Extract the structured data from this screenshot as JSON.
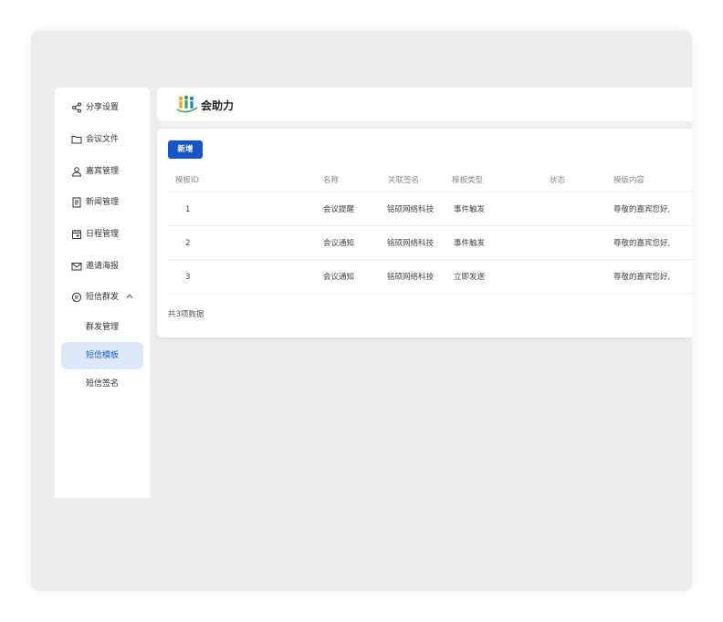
{
  "sidebar": {
    "items": [
      {
        "label": "分享设置",
        "icon": "share-icon"
      },
      {
        "label": "会议文件",
        "icon": "folder-icon"
      },
      {
        "label": "嘉宾管理",
        "icon": "user-icon"
      },
      {
        "label": "新闻管理",
        "icon": "news-icon"
      },
      {
        "label": "日程管理",
        "icon": "calendar-icon"
      },
      {
        "label": "邀请海报",
        "icon": "mail-icon"
      },
      {
        "label": "短信群发",
        "icon": "message-icon"
      }
    ],
    "sub_items": [
      {
        "label": "群发管理",
        "active": false
      },
      {
        "label": "短信模板",
        "active": true
      },
      {
        "label": "短信签名",
        "active": false
      }
    ]
  },
  "header": {
    "logo_text": "会助力",
    "logo_icon": "logo-people-icon"
  },
  "main": {
    "add_button": "新增",
    "columns": [
      "模板ID",
      "名称",
      "关联签名",
      "模板类型",
      "状态",
      "模版内容"
    ],
    "rows": [
      {
        "id": "1",
        "name": "会议提醒",
        "signature": "铭硕网络科技",
        "type": "事件触发",
        "status": "",
        "content": "尊敬的嘉宾您好,"
      },
      {
        "id": "2",
        "name": "会议通知",
        "signature": "铭硕网络科技",
        "type": "事件触发",
        "status": "",
        "content": "尊敬的嘉宾您好,"
      },
      {
        "id": "3",
        "name": "会议通知",
        "signature": "铭硕网络科技",
        "type": "立即发送",
        "status": "",
        "content": "尊敬的嘉宾您好,"
      }
    ],
    "total_text": "共3项数据"
  },
  "colors": {
    "primary": "#1654c8",
    "active_bg": "#dde8fb",
    "frame_bg": "#ededed"
  }
}
